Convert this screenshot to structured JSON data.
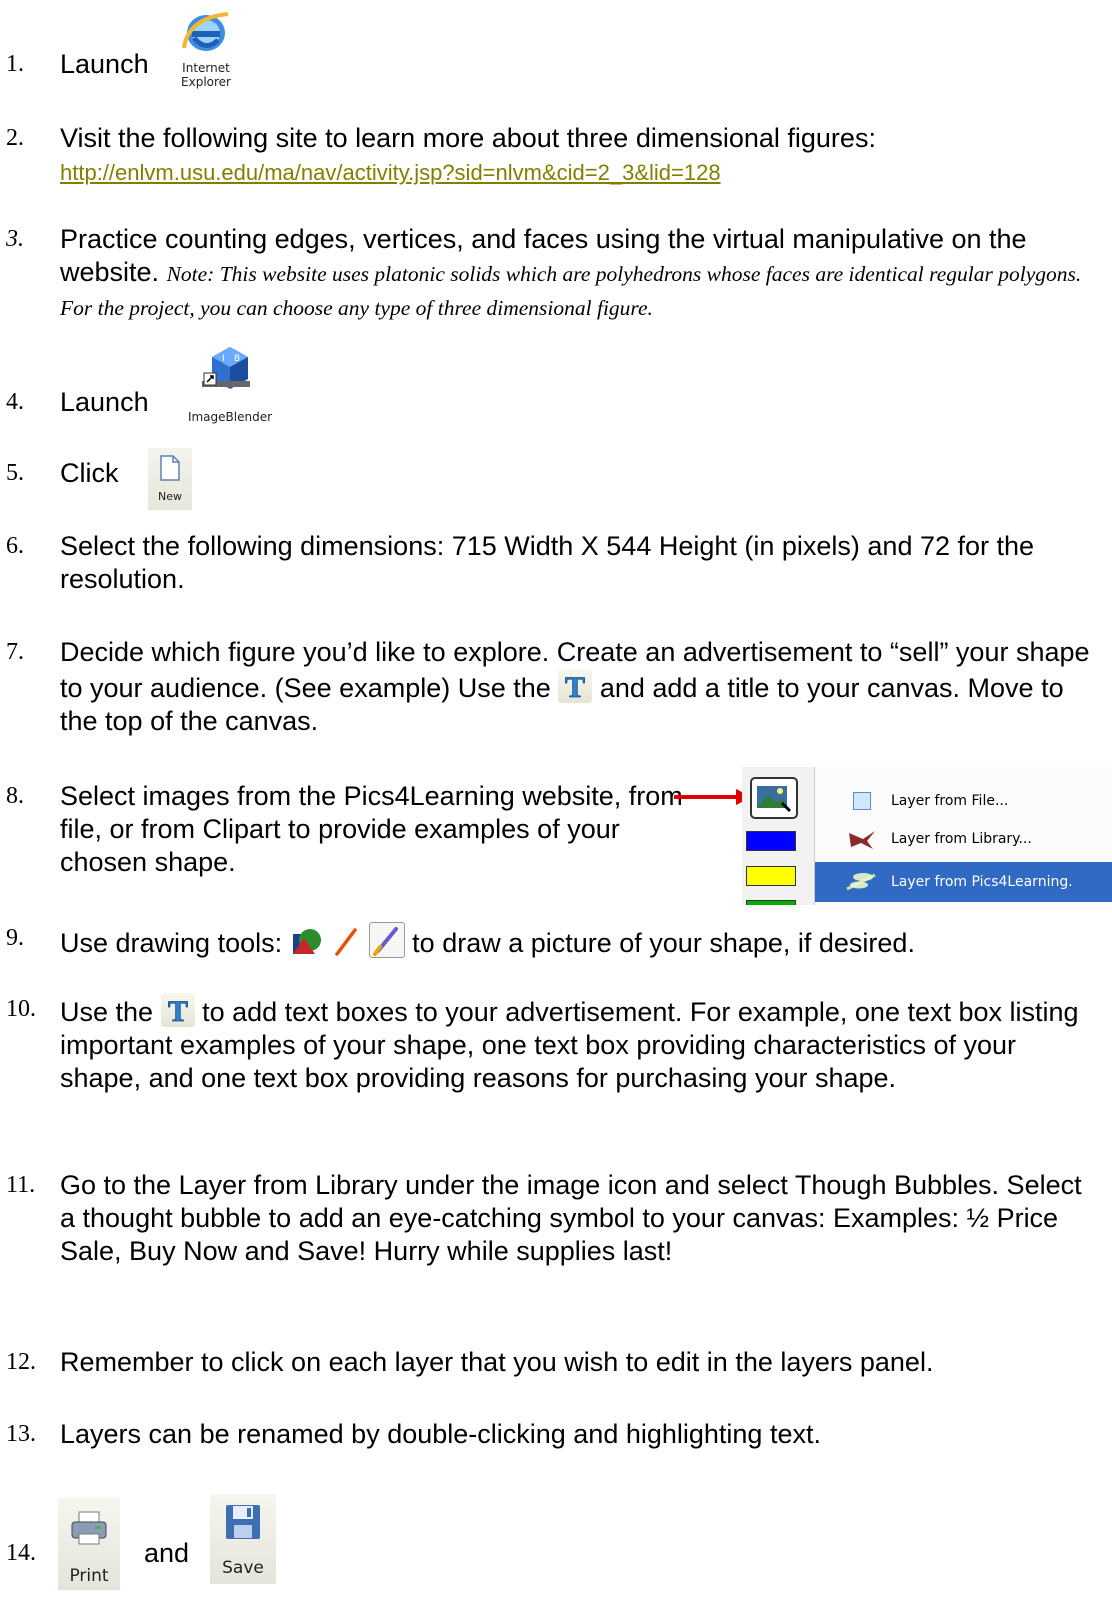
{
  "steps": [
    {
      "num": "1.",
      "text": "Launch",
      "icon_label_1": "Internet",
      "icon_label_2": "Explorer",
      "icon": "internet-explorer-icon"
    },
    {
      "num": "2.",
      "text": "Visit the following site to learn more about three dimensional figures:",
      "link": "http://enlvm.usu.edu/ma/nav/activity.jsp?sid=nlvm&cid=2_3&lid=128"
    },
    {
      "num": "3.",
      "text": "Practice counting edges, vertices, and faces using the virtual manipulative on the website.",
      "note": "Note:  This website uses platonic solids which are polyhedrons whose faces are identical regular polygons.  For the project, you can choose any type of three dimensional figure."
    },
    {
      "num": "4.",
      "text": "Launch",
      "icon_label": "ImageBlender",
      "icon": "imageblender-icon"
    },
    {
      "num": "5.",
      "text": "Click",
      "icon_label": "New",
      "icon": "new-document-icon"
    },
    {
      "num": "6.",
      "text": "Select the following dimensions:  715 Width X 544 Height (in pixels) and 72 for the resolution."
    },
    {
      "num": "7.",
      "text_a": "Decide which figure you’d like to explore.  Create an advertisement to “sell” your shape to your audience.   (See example)  Use the",
      "text_b": "and add a title to your canvas.  Move to the top of the canvas.",
      "icon": "text-tool-icon"
    },
    {
      "num": "8.",
      "text": "Select images from the Pics4Learning website, from file, or from Clipart to provide examples of your chosen shape.",
      "menu": [
        "Layer from File...",
        "Layer from Library...",
        "Layer from Pics4Learning."
      ],
      "swatch_colors": [
        "#0000ff",
        "#ffff00",
        "#00aa00"
      ]
    },
    {
      "num": "9.",
      "text_a": "Use drawing tools:",
      "text_b": "to draw a picture of your shape, if desired.",
      "icons": [
        "shapes-tool-icon",
        "pencil-tool-icon",
        "brush-tool-icon"
      ]
    },
    {
      "num": "10.",
      "text_a": "Use the",
      "text_b": "to add text boxes to your advertisement.  For example, one text box listing important examples of your shape, one text box providing characteristics of your shape, and one text box providing reasons for purchasing your shape.",
      "icon": "text-tool-icon"
    },
    {
      "num": "11.",
      "text": "Go to the Layer from Library under the image icon and select Though Bubbles.  Select a thought bubble to add an eye-catching symbol to your canvas:  Examples:  ½ Price Sale, Buy Now and Save!  Hurry while supplies last!"
    },
    {
      "num": "12.",
      "text": "Remember to click on each layer that you wish to edit in the layers panel."
    },
    {
      "num": "13.",
      "text": "Layers can be renamed by double-clicking and highlighting text."
    },
    {
      "num": "14.",
      "text": "and",
      "print_label": "Print",
      "save_label": "Save",
      "icons": [
        "print-icon",
        "save-icon"
      ]
    }
  ],
  "colors": {
    "link": "#808000",
    "highlight": "#316ac5",
    "arrow": "#e00000"
  }
}
